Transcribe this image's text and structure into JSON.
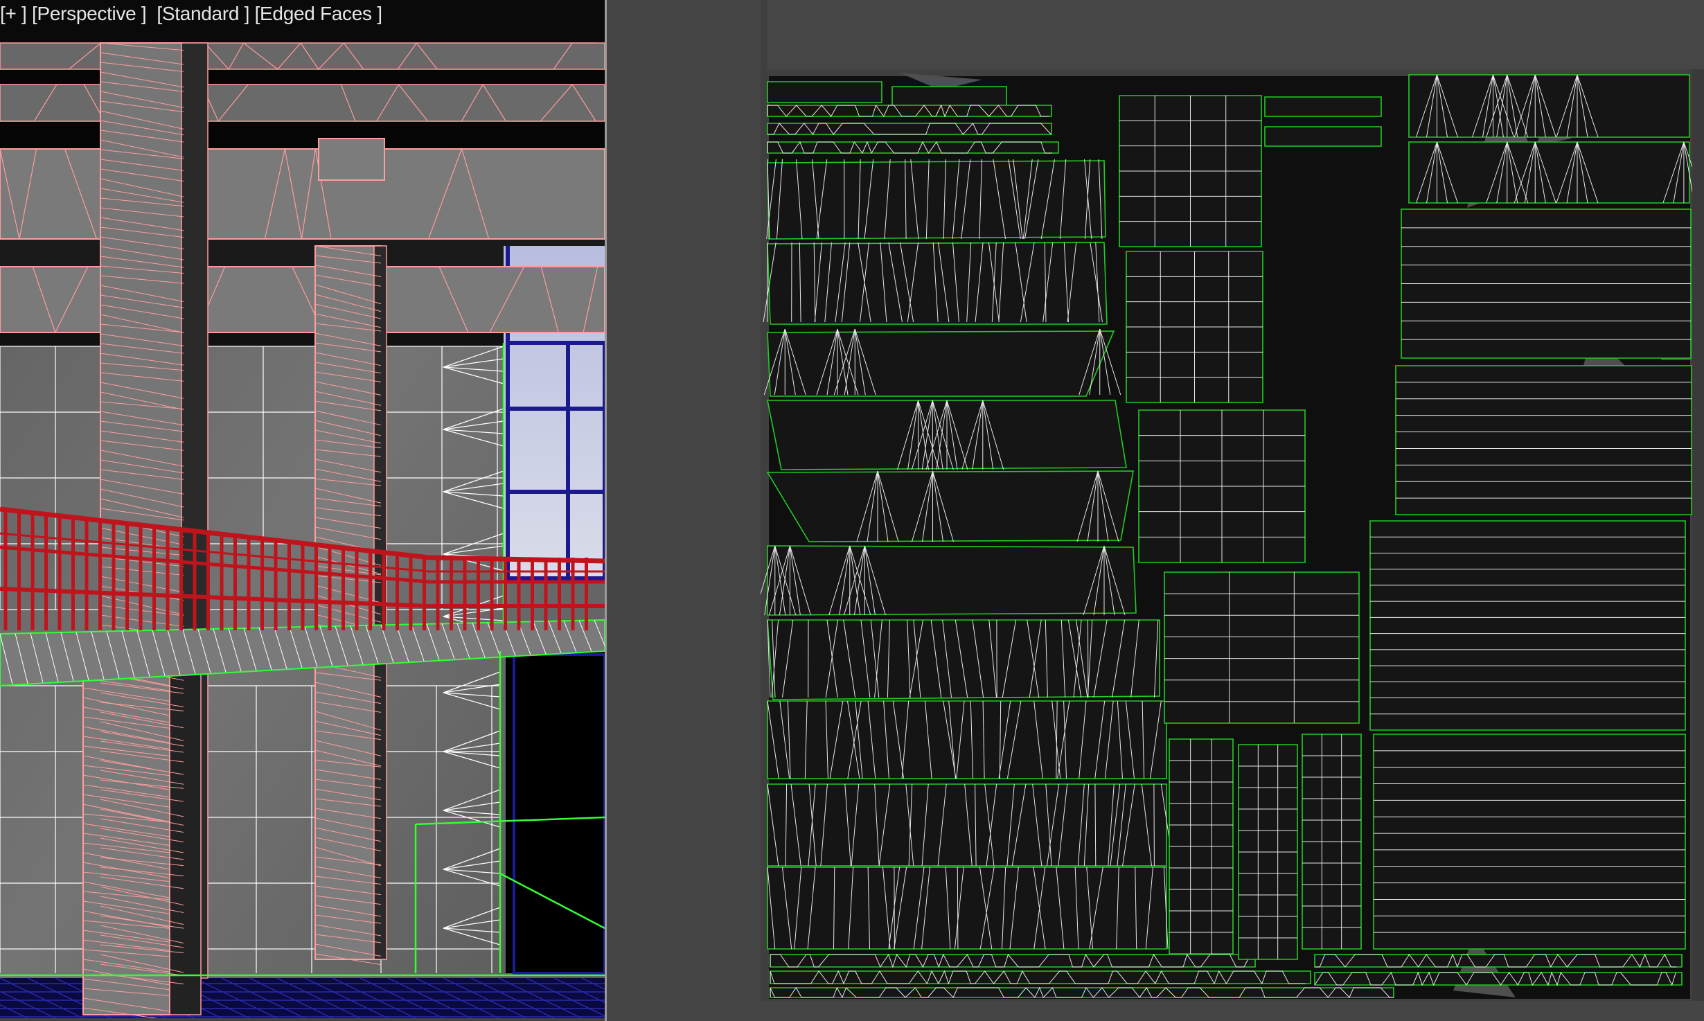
{
  "viewport": {
    "labels": {
      "plus": "[+ ]",
      "view": "[Perspective ]",
      "shading": "[Standard ]",
      "edges": "[Edged Faces ]"
    },
    "colors": {
      "wireframe_selected": "#ff9d9d",
      "wireframe_object": "#ffffff",
      "edge_highlight": "#33ff33",
      "railing": "#c0141c",
      "window_frame": "#1a1a8c",
      "sky": "#c4c8e0",
      "concrete": "#6e6e6e"
    }
  },
  "uv_editor": {
    "colors": {
      "island_border": "#22cc22",
      "island_wire": "#ffffff",
      "texture_bg": "#0e0e0e",
      "panel_bg": "#464646"
    }
  }
}
